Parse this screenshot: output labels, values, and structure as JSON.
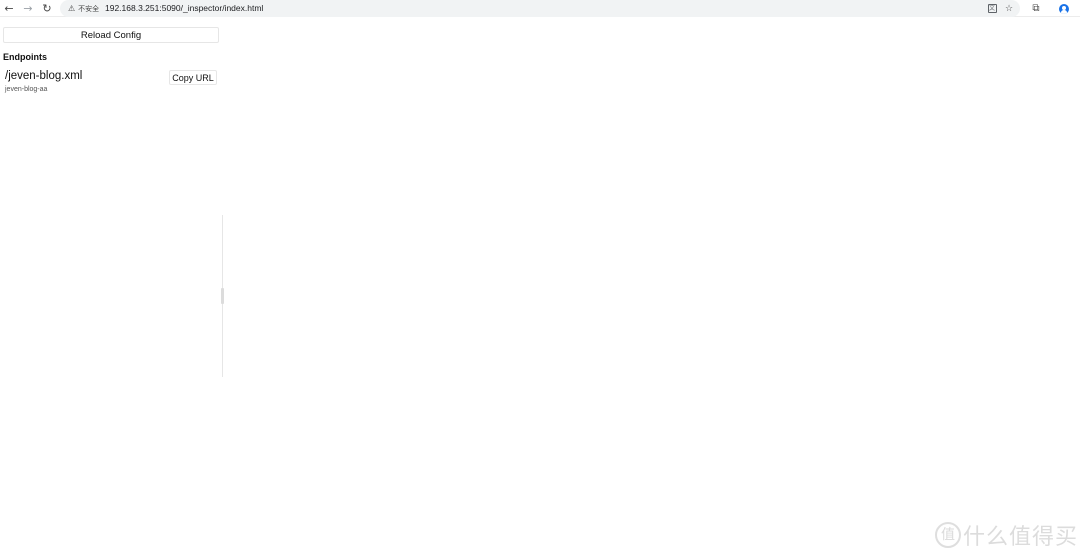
{
  "browser": {
    "security_label": "不安全",
    "url": "192.168.3.251:5090/_inspector/index.html"
  },
  "icons": {
    "back": "back-arrow-icon",
    "forward": "forward-arrow-icon",
    "reload": "reload-icon",
    "warning": "warning-triangle-icon",
    "translate": "translate-icon",
    "bookmark": "star-icon",
    "extensions": "puzzle-icon",
    "profile": "avatar-icon"
  },
  "page": {
    "reload_label": "Reload Config",
    "endpoints_heading": "Endpoints",
    "endpoints": [
      {
        "path": "/jeven-blog.xml",
        "id": "jeven-blog-aa",
        "copy_label": "Copy URL"
      }
    ]
  },
  "watermark": {
    "logo_glyph": "值",
    "text": "什么值得买"
  }
}
